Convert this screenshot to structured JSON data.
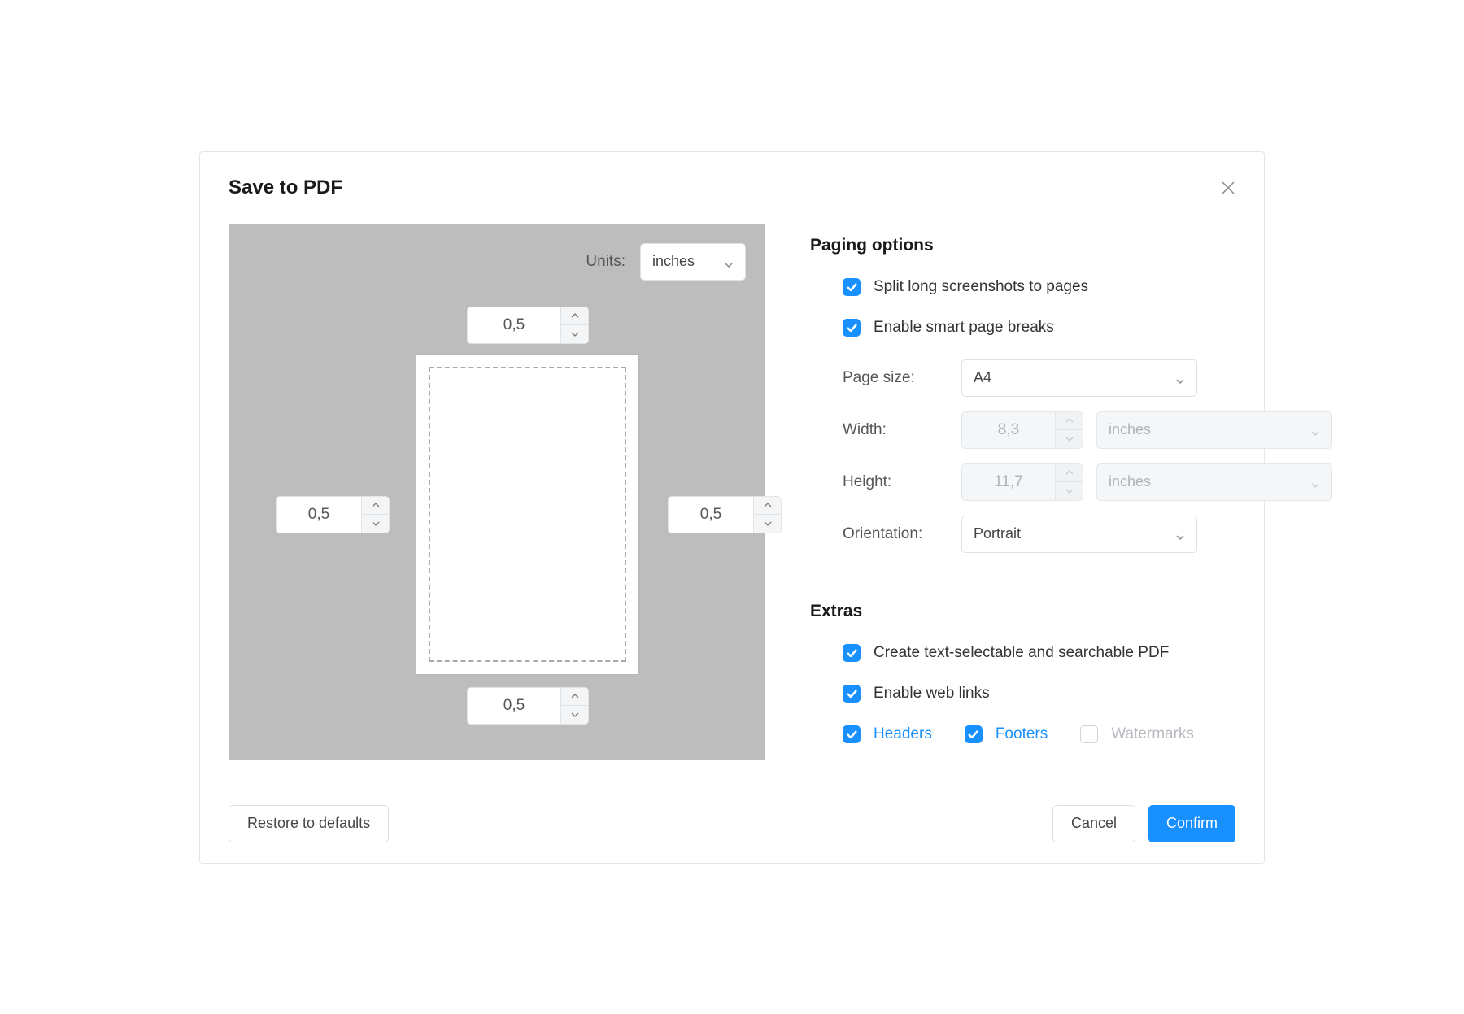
{
  "dialog": {
    "title": "Save to PDF"
  },
  "preview": {
    "units_label": "Units:",
    "units_value": "inches",
    "margin_top": "0,5",
    "margin_bottom": "0,5",
    "margin_left": "0,5",
    "margin_right": "0,5"
  },
  "paging": {
    "title": "Paging options",
    "split_label": "Split long screenshots to pages",
    "smart_breaks_label": "Enable smart page breaks",
    "page_size_label": "Page size:",
    "page_size_value": "A4",
    "width_label": "Width:",
    "width_value": "8,3",
    "width_unit": "inches",
    "height_label": "Height:",
    "height_value": "11,7",
    "height_unit": "inches",
    "orientation_label": "Orientation:",
    "orientation_value": "Portrait"
  },
  "extras": {
    "title": "Extras",
    "text_selectable_label": "Create text-selectable and searchable PDF",
    "web_links_label": "Enable web links",
    "headers_label": "Headers",
    "footers_label": "Footers",
    "watermarks_label": "Watermarks"
  },
  "footer": {
    "restore": "Restore to defaults",
    "cancel": "Cancel",
    "confirm": "Confirm"
  }
}
